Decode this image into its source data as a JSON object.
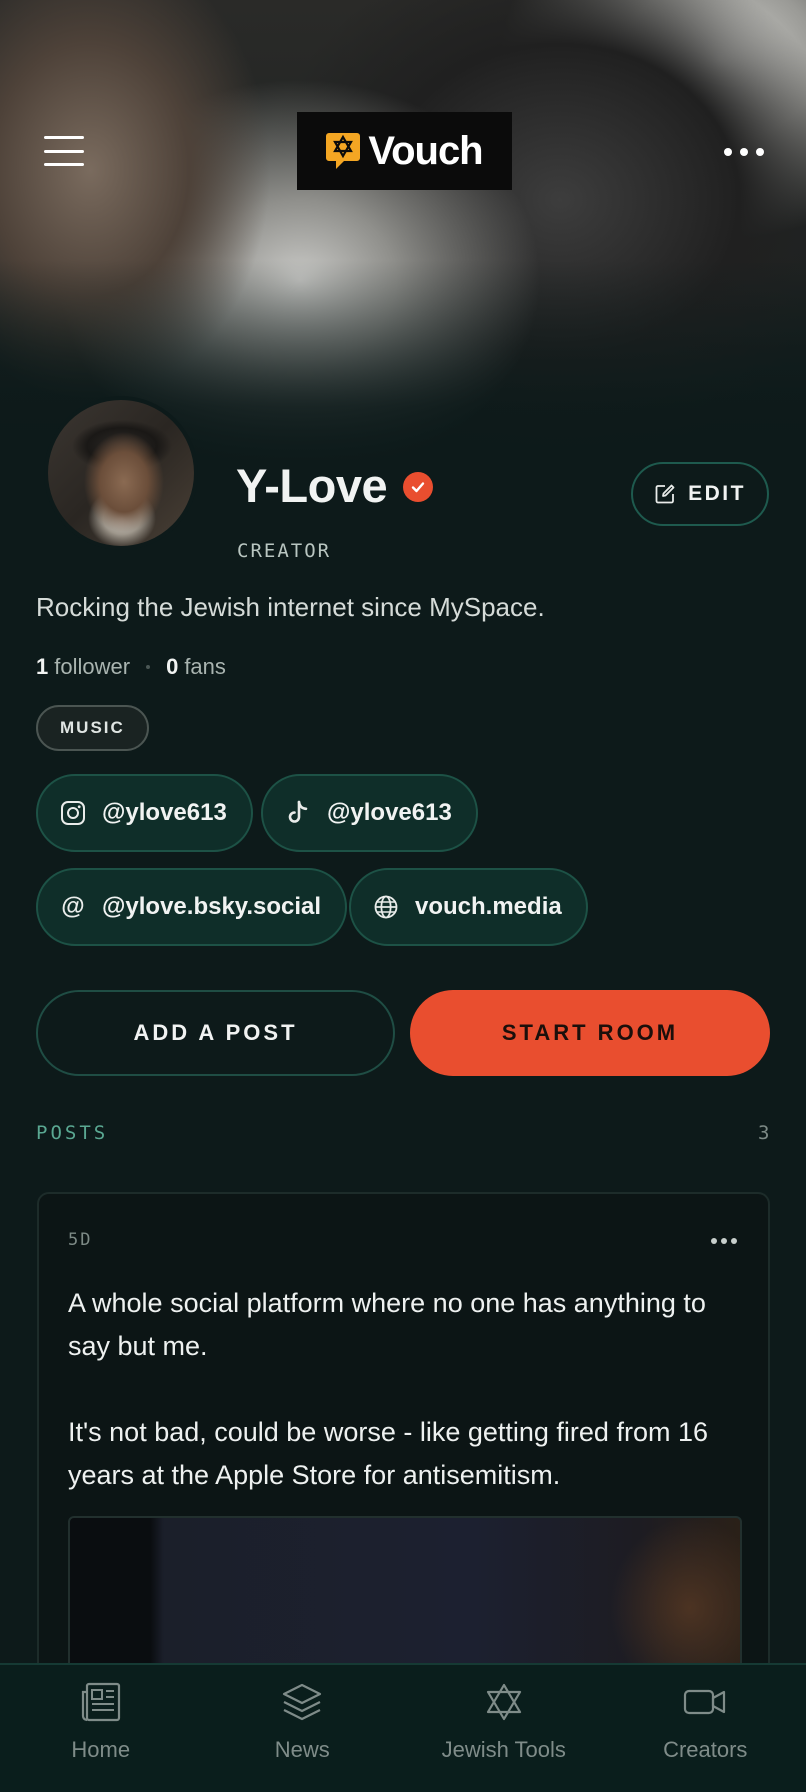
{
  "header": {
    "logo_text": "Vouch",
    "menu_icon": "hamburger-menu-icon",
    "more_icon": "more-horizontal-icon"
  },
  "profile": {
    "name": "Y-Love",
    "role": "CREATOR",
    "edit_label": "EDIT",
    "bio": "Rocking the Jewish internet since MySpace.",
    "followers_count": "1",
    "followers_label": "follower",
    "fans_count": "0",
    "fans_label": "fans",
    "tag": "MUSIC"
  },
  "socials": [
    {
      "icon": "instagram-icon",
      "label": "@ylove613"
    },
    {
      "icon": "tiktok-icon",
      "label": "@ylove613"
    },
    {
      "icon": "at-sign-icon",
      "label": "@ylove.bsky.social"
    },
    {
      "icon": "globe-icon",
      "label": "vouch.media"
    }
  ],
  "actions": {
    "add_post": "ADD A POST",
    "start_room": "START ROOM"
  },
  "posts": {
    "label": "POSTS",
    "count": "3",
    "items": [
      {
        "time": "5D",
        "paragraphs": [
          "A whole social platform where no one has anything to say but me.",
          "It's not bad, could be worse - like getting fired from 16 years at the Apple Store for antisemitism."
        ]
      }
    ]
  },
  "nav": [
    {
      "icon": "newspaper-icon",
      "label": "Home"
    },
    {
      "icon": "layers-icon",
      "label": "News"
    },
    {
      "icon": "star-of-david-icon",
      "label": "Jewish Tools"
    },
    {
      "icon": "video-camera-icon",
      "label": "Creators"
    }
  ],
  "colors": {
    "background": "#0d1a1a",
    "accent": "#e94e2f",
    "brand_yellow": "#f4a623",
    "teal": "#5aa892"
  }
}
